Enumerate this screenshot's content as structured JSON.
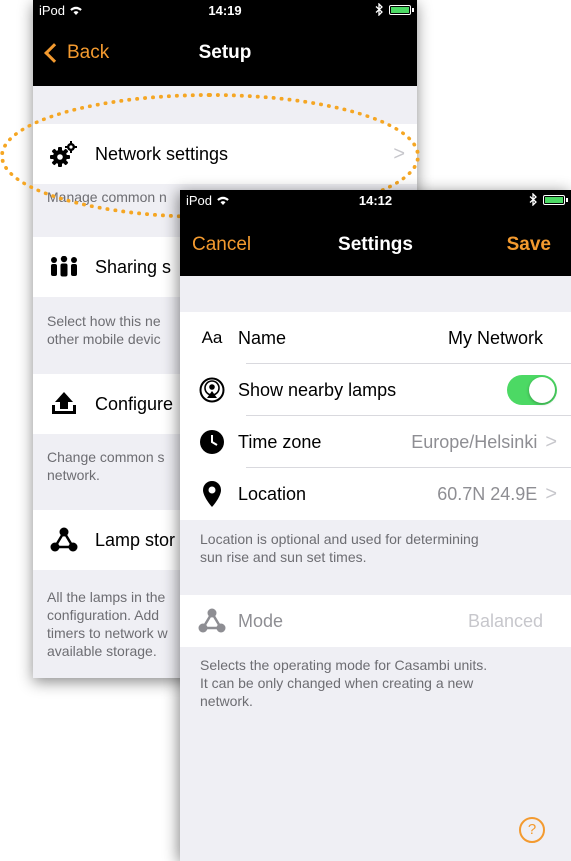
{
  "setup": {
    "status": {
      "carrier": "iPod",
      "time": "14:19"
    },
    "nav": {
      "back": "Back",
      "title": "Setup"
    },
    "network_settings": {
      "label": "Network settings",
      "desc": "Manage common n"
    },
    "sharing": {
      "label": "Sharing s",
      "desc_line1": "Select how this ne",
      "desc_line2": "other mobile devic"
    },
    "configure": {
      "label": "Configure",
      "desc_line1": "Change common s",
      "desc_line2": "network."
    },
    "lamp_storage": {
      "label": "Lamp stor",
      "desc_line1": "All the lamps in the",
      "desc_line2": "configuration. Add",
      "desc_line3": "timers to network w",
      "desc_line4": "available storage."
    },
    "chevron": ">"
  },
  "settings": {
    "status": {
      "carrier": "iPod",
      "time": "14:12"
    },
    "nav": {
      "cancel": "Cancel",
      "title": "Settings",
      "save": "Save"
    },
    "name": {
      "icon_text": "Aa",
      "label": "Name",
      "value": "My Network"
    },
    "nearby": {
      "label": "Show nearby lamps",
      "enabled": true
    },
    "timezone": {
      "label": "Time zone",
      "value": "Europe/Helsinki"
    },
    "location": {
      "label": "Location",
      "value": "60.7N 24.9E",
      "desc_line1": "Location is optional and used for determining",
      "desc_line2": "sun rise and sun set times."
    },
    "mode": {
      "label": "Mode",
      "value": "Balanced",
      "desc_line1": "Selects the operating mode for Casambi units.",
      "desc_line2": "It can be only changed when creating a new",
      "desc_line3": "network."
    },
    "chevron": ">",
    "help": "?"
  },
  "colors": {
    "accent": "#f39a2f",
    "toggle_on": "#4cd964",
    "highlight_ring": "#f5a623"
  },
  "icons": [
    "gears-icon",
    "people-icon",
    "upload-icon",
    "lamp-network-icon",
    "font-icon",
    "nearby-lamps-icon",
    "clock-icon",
    "location-pin-icon",
    "mode-icon",
    "help-icon",
    "bluetooth-icon",
    "wifi-icon",
    "battery-icon"
  ]
}
